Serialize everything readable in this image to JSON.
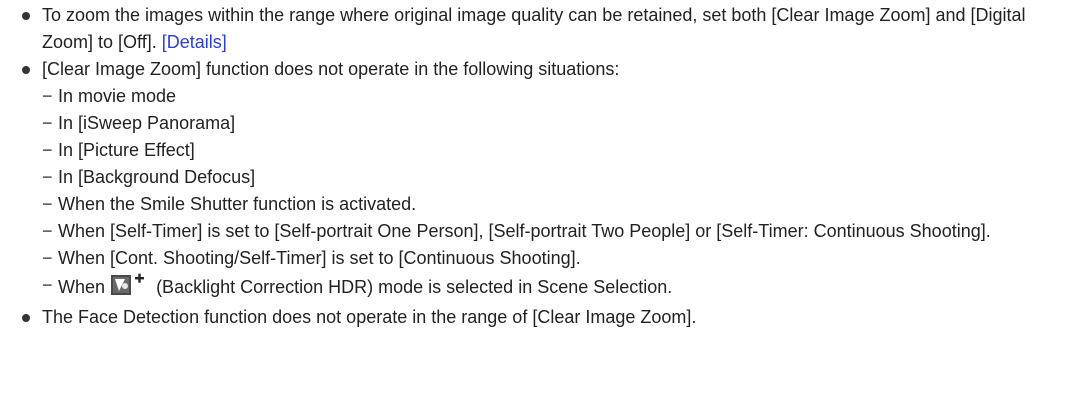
{
  "bullets": [
    {
      "text": "To zoom the images within the range where original image quality can be retained, set both [Clear Image Zoom] and [Digital Zoom] to [Off].",
      "link": "[Details]"
    },
    {
      "text": "[Clear Image Zoom] function does not operate in the following situations:",
      "subitems": [
        "In movie mode",
        "In [iSweep Panorama]",
        "In [Picture Effect]",
        "In [Background Defocus]",
        "When the Smile Shutter function is activated.",
        "When [Self-Timer] is set to [Self-portrait One Person], [Self-portrait Two People] or [Self-Timer: Continuous Shooting].",
        "When [Cont. Shooting/Self-Timer] is set to [Continuous Shooting]."
      ],
      "last_subitem": {
        "before": "When",
        "icon": "backlight-correction-hdr-icon",
        "after": "(Backlight Correction HDR) mode is selected in Scene Selection."
      }
    },
    {
      "text": "The Face Detection function does not operate in the range of [Clear Image Zoom]."
    }
  ],
  "dash_glyph": "−"
}
